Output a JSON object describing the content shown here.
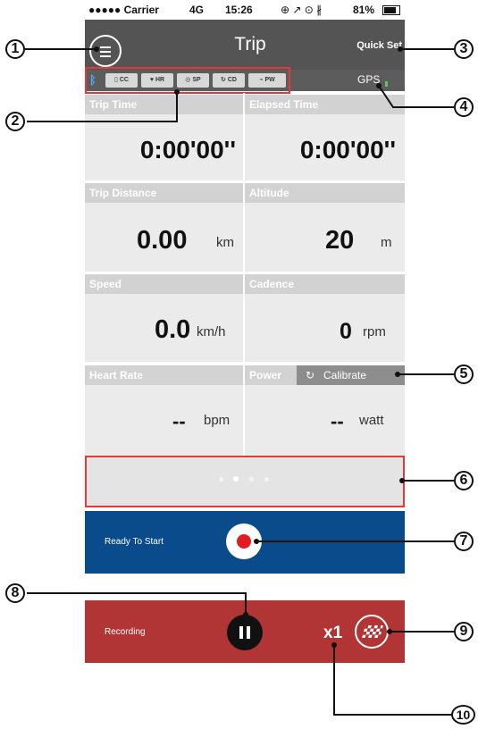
{
  "status_bar": {
    "carrier": "●●●●● Carrier",
    "network": "4G",
    "time": "15:26",
    "icons": "⊕ ↗ ⊙ ∦",
    "battery": "81%"
  },
  "header": {
    "title": "Trip",
    "quick_set": "Quick Set",
    "menu_icon": "menu-icon"
  },
  "sensors": {
    "bluetooth_icon": "bluetooth-icon",
    "items": [
      "CC",
      "HR",
      "SP",
      "CD",
      "PW"
    ],
    "gps": "GPS"
  },
  "fields": {
    "trip_time": {
      "label": "Trip Time",
      "value": "0:00'00''"
    },
    "elapsed_time": {
      "label": "Elapsed Time",
      "value": "0:00'00''"
    },
    "trip_distance": {
      "label": "Trip Distance",
      "value": "0.00",
      "unit": "km"
    },
    "altitude": {
      "label": "Altitude",
      "value": "20",
      "unit": "m"
    },
    "speed": {
      "label": "Speed",
      "value": "0.0",
      "unit": "km/h"
    },
    "cadence": {
      "label": "Cadence",
      "value": "0",
      "unit": "rpm"
    },
    "heart_rate": {
      "label": "Heart Rate",
      "value": "--",
      "unit": "bpm"
    },
    "power": {
      "label": "Power",
      "value": "--",
      "unit": "watt",
      "calibrate": "Calibrate"
    }
  },
  "pager": {
    "pages": 4,
    "active": 1
  },
  "ready": {
    "label": "Ready To Start"
  },
  "recording": {
    "label": "Recording",
    "multiplier": "x1"
  },
  "callouts": [
    "1",
    "2",
    "3",
    "4",
    "5",
    "6",
    "7",
    "8",
    "9",
    "10"
  ],
  "colors": {
    "header": "#545454",
    "ready": "#0a4b8c",
    "recording": "#b23535",
    "record_dot": "#e21b22",
    "highlight": "#e23a3a",
    "gps": "#4fd34f"
  }
}
